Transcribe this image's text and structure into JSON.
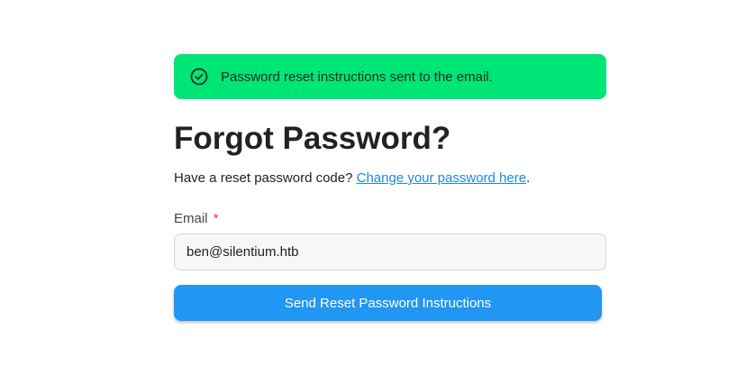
{
  "alert": {
    "icon": "check-circle-icon",
    "message": "Password reset instructions sent to the email.",
    "color": "#00e676"
  },
  "title": "Forgot Password?",
  "subtitle": {
    "text": "Have a reset password code? ",
    "link": "Change your password here",
    "suffix": "."
  },
  "form": {
    "email_label": "Email",
    "required_mark": "*",
    "email_value": "ben@silentium.htb",
    "submit_label": "Send Reset Password Instructions"
  },
  "colors": {
    "primary": "#2196f3",
    "success": "#00e676",
    "link": "#1e88e5",
    "required": "#e53935"
  }
}
